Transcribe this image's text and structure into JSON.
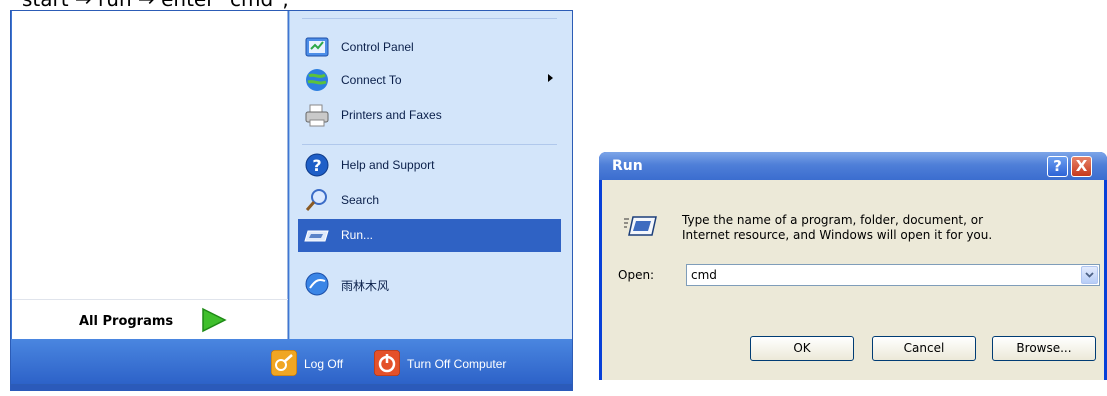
{
  "caption": "start → run → enter \"cmd\";",
  "start_menu": {
    "items": [
      {
        "label": "Control Panel",
        "icon": "control-panel-icon"
      },
      {
        "label": "Connect To",
        "icon": "connect-to-icon",
        "has_submenu": true
      },
      {
        "label": "Printers and Faxes",
        "icon": "printers-icon"
      },
      {
        "label": "Help and Support",
        "icon": "help-icon"
      },
      {
        "label": "Search",
        "icon": "search-icon"
      },
      {
        "label": "Run...",
        "icon": "run-icon",
        "highlighted": true
      },
      {
        "label": "雨林木风",
        "icon": "globe-icon"
      }
    ],
    "all_programs": "All Programs",
    "log_off": "Log Off",
    "turn_off": "Turn Off Computer"
  },
  "run_dialog": {
    "title": "Run",
    "help_button": "?",
    "close_button": "X",
    "description_line1": "Type the name of a program, folder, document, or",
    "description_line2": "Internet resource, and Windows will open it for you.",
    "open_label": "Open:",
    "open_value": "cmd",
    "ok": "OK",
    "cancel": "Cancel",
    "browse": "Browse..."
  },
  "colors": {
    "menu_blue": "#3f76d3",
    "highlight": "#2f62c4",
    "dialog_face": "#ece9d8"
  }
}
